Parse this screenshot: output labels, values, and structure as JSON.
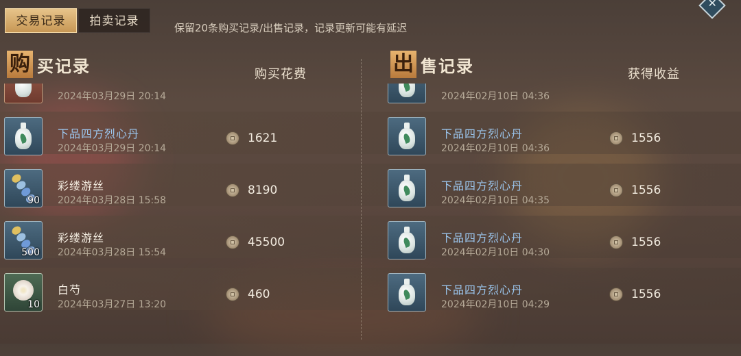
{
  "tabs": [
    {
      "label": "交易记录",
      "active": true
    },
    {
      "label": "拍卖记录",
      "active": false
    }
  ],
  "notice": "保留20条购买记录/出售记录，记录更新可能有延迟",
  "corner_icon": "close-diamond-icon",
  "buy": {
    "title_char": "购",
    "title_rest": "买记录",
    "column": "购买花费",
    "items": [
      {
        "name": "",
        "time": "2024年03月29日 20:14",
        "price": "",
        "icon": "vase-icon",
        "qty": "",
        "name_color": "white"
      },
      {
        "name": "下品四方烈心丹",
        "time": "2024年03月29日 20:14",
        "price": "1621",
        "icon": "vase-icon",
        "qty": "",
        "name_color": "blue"
      },
      {
        "name": "彩缕游丝",
        "time": "2024年03月28日 15:58",
        "price": "8190",
        "icon": "silk-icon",
        "qty": "90",
        "name_color": "white"
      },
      {
        "name": "彩缕游丝",
        "time": "2024年03月28日 15:54",
        "price": "45500",
        "icon": "silk-icon",
        "qty": "500",
        "name_color": "white"
      },
      {
        "name": "白芍",
        "time": "2024年03月27日 13:20",
        "price": "460",
        "icon": "flower-icon",
        "qty": "10",
        "name_color": "white"
      }
    ]
  },
  "sell": {
    "title_char": "出",
    "title_rest": "售记录",
    "column": "获得收益",
    "items": [
      {
        "name": "",
        "time": "2024年02月10日 04:36",
        "price": "",
        "icon": "vase-icon",
        "qty": "",
        "name_color": "blue"
      },
      {
        "name": "下品四方烈心丹",
        "time": "2024年02月10日 04:36",
        "price": "1556",
        "icon": "vase-icon",
        "qty": "",
        "name_color": "blue"
      },
      {
        "name": "下品四方烈心丹",
        "time": "2024年02月10日 04:35",
        "price": "1556",
        "icon": "vase-icon",
        "qty": "",
        "name_color": "blue"
      },
      {
        "name": "下品四方烈心丹",
        "time": "2024年02月10日 04:30",
        "price": "1556",
        "icon": "vase-icon",
        "qty": "",
        "name_color": "blue"
      },
      {
        "name": "下品四方烈心丹",
        "time": "2024年02月10日 04:29",
        "price": "1556",
        "icon": "vase-icon",
        "qty": "",
        "name_color": "blue"
      }
    ]
  },
  "colors": {
    "accent": "#d9ad6c",
    "blue_name": "#9cc7ef"
  }
}
